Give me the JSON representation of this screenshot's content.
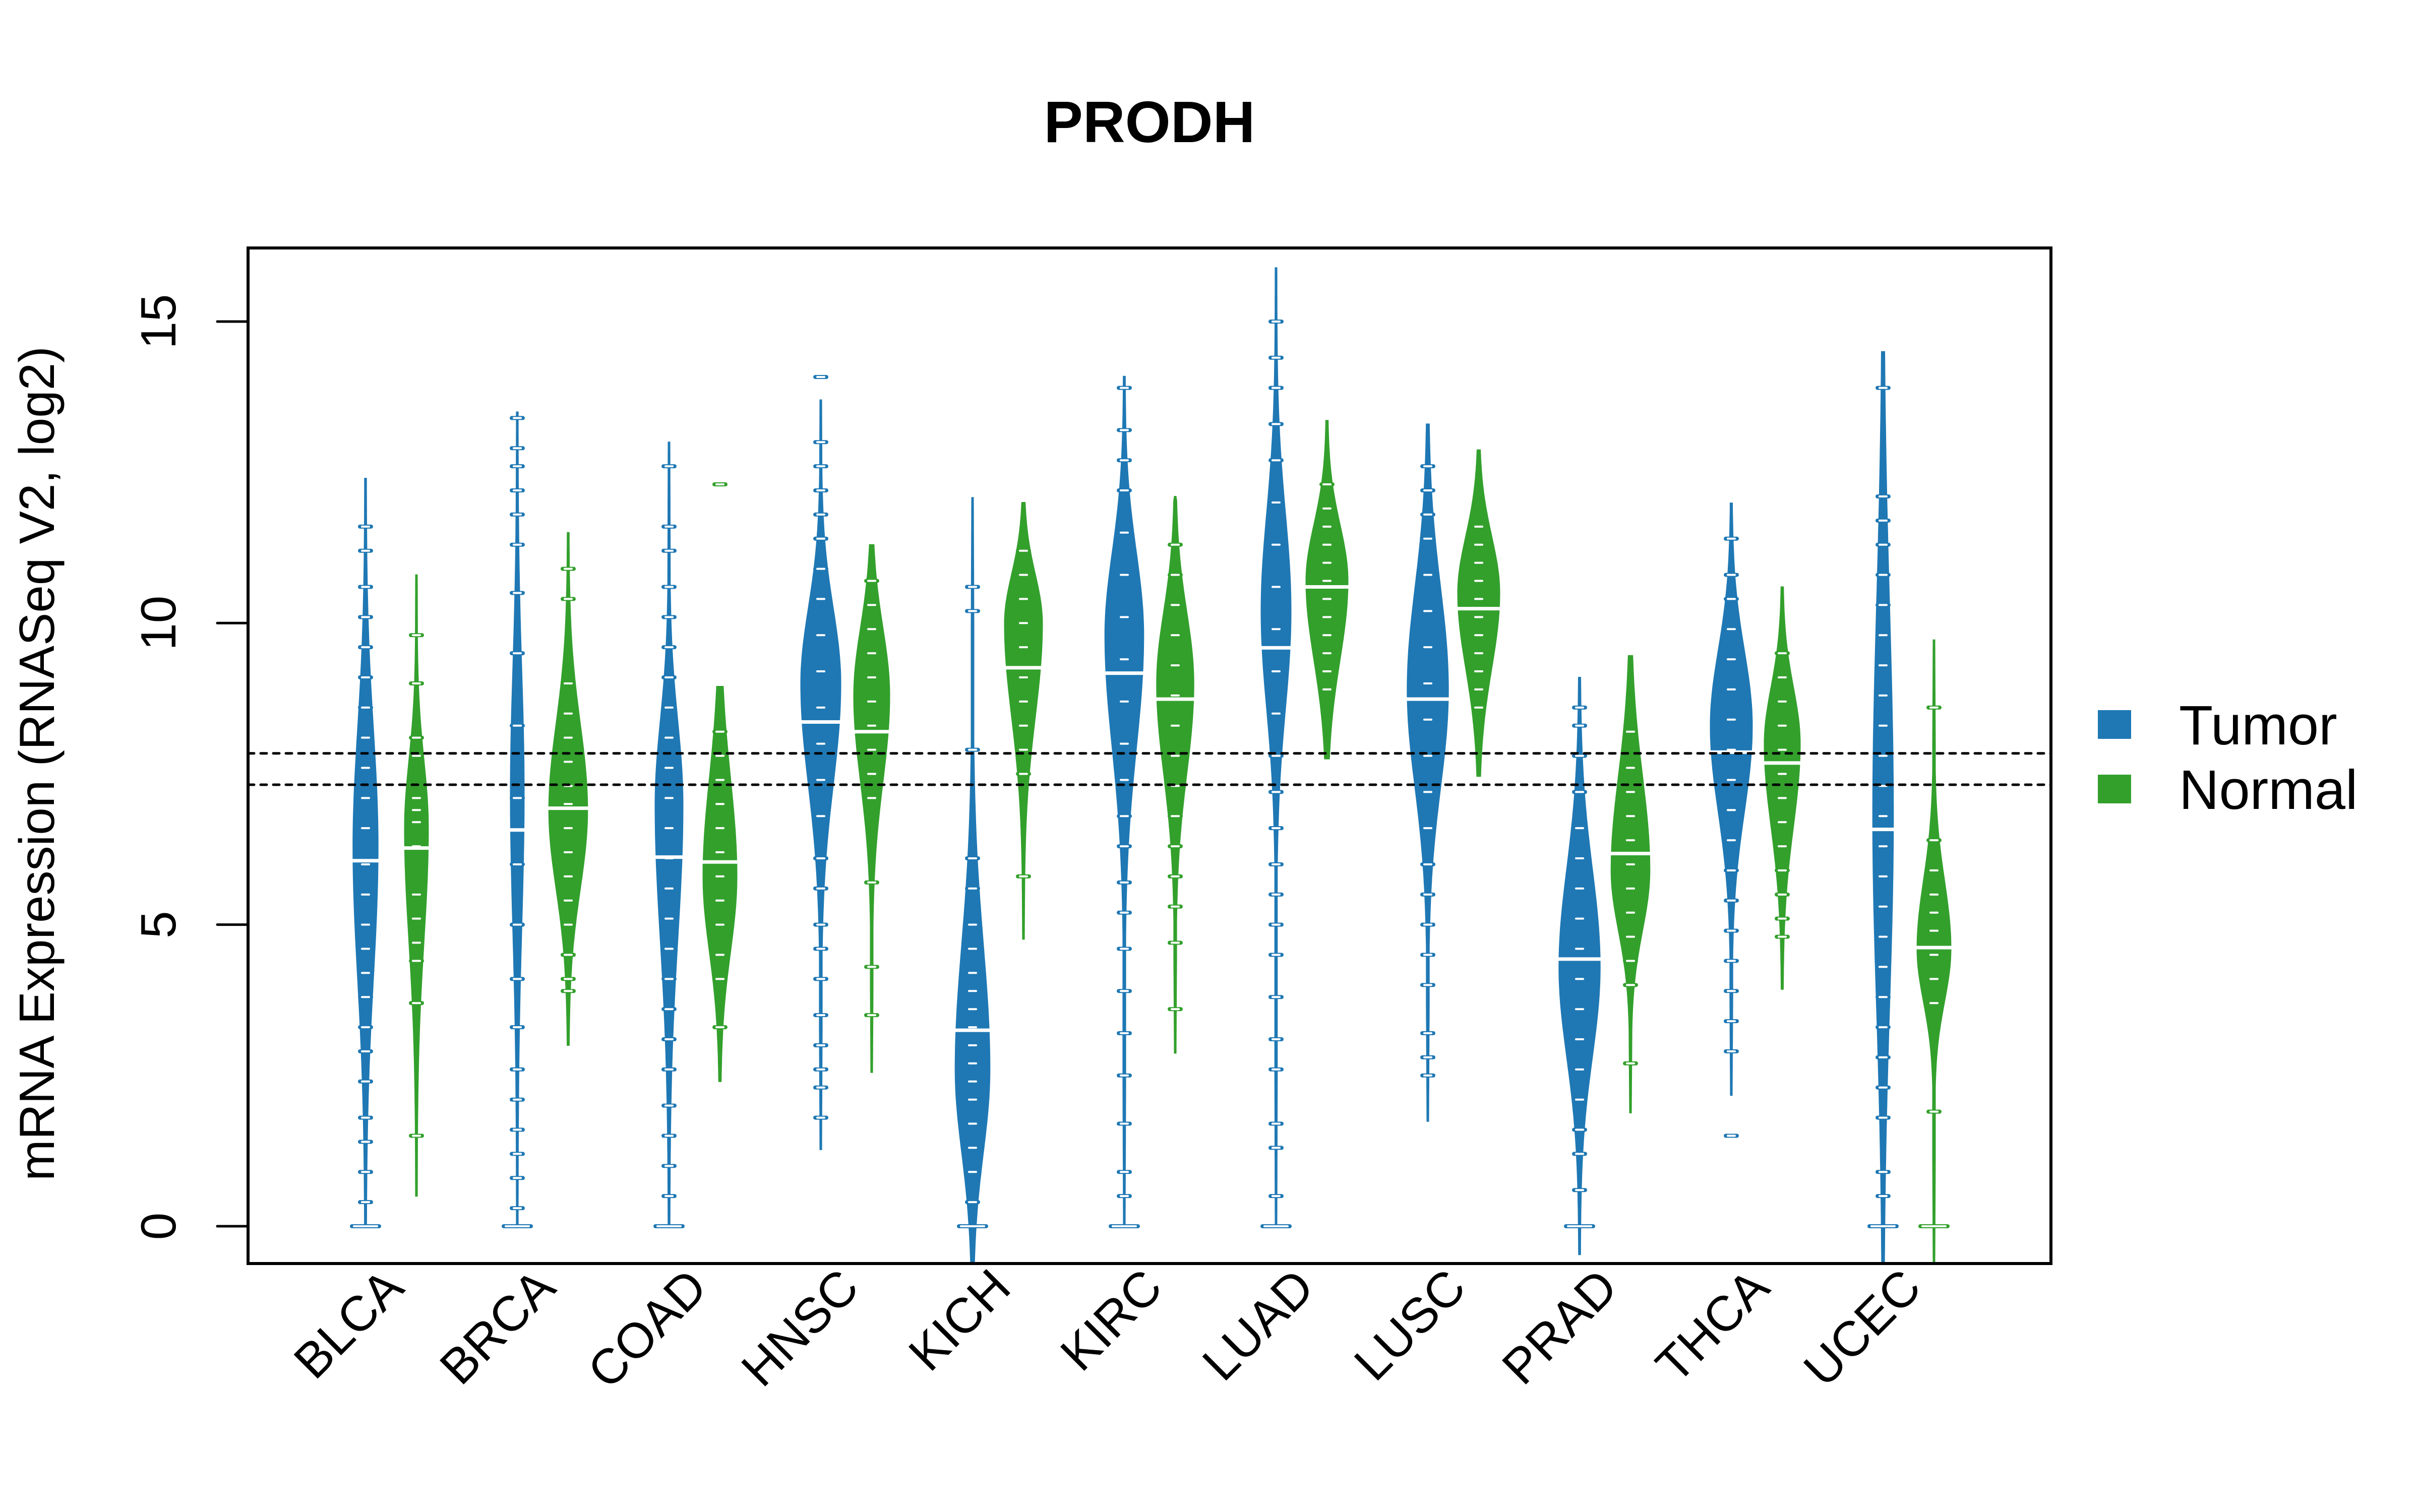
{
  "chart_data": {
    "type": "violin",
    "title": "PRODH",
    "xlabel": "",
    "ylabel": "mRNA Expression (RNASeq V2, log2)",
    "ylim": [
      -0.62,
      16.2
    ],
    "yticks": [
      0,
      5,
      10,
      15
    ],
    "ytick_labels": [
      "0",
      "5",
      "10",
      "15"
    ],
    "grid": false,
    "reference_lines": [
      7.84,
      7.32
    ],
    "legend": {
      "position": "right",
      "entries": [
        {
          "name": "Tumor",
          "color": "#1f78b4"
        },
        {
          "name": "Normal",
          "color": "#33a02c"
        }
      ]
    },
    "categories": [
      "BLCA",
      "BRCA",
      "COAD",
      "HNSC",
      "KICH",
      "KIRC",
      "LUAD",
      "LUSC",
      "PRAD",
      "THCA",
      "UCEC"
    ],
    "series": [
      {
        "name": "Tumor",
        "color": "#1f78b4",
        "values": [
          {
            "min": 0.0,
            "max": 12.4,
            "median": 6.06,
            "mode": 6.3,
            "body_low": 2.8,
            "body_high": 9.4,
            "width": 0.58,
            "points": [
              0,
              0.4,
              0.9,
              1.4,
              1.8,
              2.4,
              2.9,
              3.3,
              3.8,
              4.2,
              4.6,
              5.0,
              5.5,
              6.0,
              6.6,
              7.1,
              7.6,
              8.1,
              8.6,
              9.1,
              9.6,
              10.1,
              10.6,
              11.2,
              11.6
            ]
          },
          {
            "min": 0.0,
            "max": 13.5,
            "median": 6.57,
            "mode": 7.2,
            "body_low": 3.6,
            "body_high": 10.4,
            "width": 0.3,
            "points": [
              0,
              0.3,
              0.8,
              1.2,
              1.6,
              2.1,
              2.6,
              3.3,
              4.1,
              5.0,
              6.0,
              7.1,
              8.3,
              9.5,
              10.5,
              11.3,
              11.8,
              12.2,
              12.6,
              12.9,
              13.4
            ]
          },
          {
            "min": 0.0,
            "max": 13.0,
            "median": 6.12,
            "mode": 7.0,
            "body_low": 3.4,
            "body_high": 9.2,
            "width": 0.65,
            "points": [
              0,
              0.5,
              1.0,
              1.5,
              2.0,
              2.6,
              3.1,
              3.6,
              4.1,
              4.6,
              5.1,
              5.6,
              6.1,
              6.6,
              7.1,
              7.6,
              8.1,
              8.6,
              9.1,
              9.6,
              10.1,
              10.6,
              11.2,
              11.6,
              12.6
            ]
          },
          {
            "min": 1.27,
            "max": 13.7,
            "median": 8.36,
            "mode": 9.0,
            "body_low": 6.3,
            "body_high": 11.0,
            "width": 0.95,
            "points": [
              1.8,
              2.3,
              2.6,
              3.0,
              3.5,
              4.1,
              4.6,
              5.0,
              5.6,
              6.1,
              6.8,
              7.4,
              8.0,
              8.6,
              9.2,
              9.8,
              10.4,
              10.9,
              11.4,
              11.8,
              12.2,
              12.6,
              13.0,
              14.08
            ]
          },
          {
            "min": -0.62,
            "max": 12.08,
            "median": 3.25,
            "mode": 2.6,
            "body_low": 0.4,
            "body_high": 5.9,
            "width": 0.82,
            "points": [
              0,
              0.4,
              0.9,
              1.3,
              1.7,
              2.1,
              2.4,
              2.7,
              3.0,
              3.3,
              3.6,
              3.9,
              4.2,
              4.6,
              5.0,
              5.6,
              6.1,
              7.9,
              10.2,
              10.6
            ]
          },
          {
            "min": 0.0,
            "max": 14.09,
            "median": 9.17,
            "mode": 9.8,
            "body_low": 6.8,
            "body_high": 12.0,
            "width": 0.92,
            "points": [
              0,
              0.5,
              0.9,
              1.7,
              2.5,
              3.2,
              3.9,
              4.6,
              5.2,
              5.7,
              6.3,
              6.8,
              7.4,
              8.0,
              8.7,
              9.4,
              10.1,
              10.8,
              11.5,
              12.2,
              12.7,
              13.2,
              13.9
            ]
          },
          {
            "min": 0.0,
            "max": 15.89,
            "median": 9.59,
            "mode": 10.2,
            "body_low": 7.6,
            "body_high": 12.8,
            "width": 0.7,
            "points": [
              0,
              0.5,
              1.3,
              1.7,
              2.6,
              3.1,
              3.8,
              4.5,
              5.0,
              5.5,
              6.0,
              6.6,
              7.2,
              7.8,
              8.5,
              9.2,
              9.9,
              10.6,
              11.3,
              12.0,
              12.7,
              13.3,
              13.9,
              14.4,
              15.0
            ]
          },
          {
            "min": 1.74,
            "max": 13.3,
            "median": 8.74,
            "mode": 8.9,
            "body_low": 6.3,
            "body_high": 11.6,
            "width": 0.98,
            "points": [
              2.5,
              2.8,
              3.2,
              4.0,
              4.5,
              5.0,
              5.5,
              6.0,
              6.6,
              7.2,
              7.8,
              8.4,
              9.0,
              9.6,
              10.2,
              10.8,
              11.4,
              11.8,
              12.2,
              12.6
            ]
          },
          {
            "min": -0.47,
            "max": 9.1,
            "median": 4.43,
            "mode": 4.3,
            "body_low": 1.9,
            "body_high": 6.9,
            "width": 0.98,
            "points": [
              0,
              0.6,
              1.2,
              1.6,
              2.1,
              2.6,
              3.1,
              3.6,
              4.1,
              4.6,
              5.1,
              5.6,
              6.1,
              6.6,
              7.2,
              7.8,
              8.3,
              8.6
            ]
          },
          {
            "min": 2.17,
            "max": 11.99,
            "median": 7.86,
            "mode": 8.3,
            "body_low": 6.0,
            "body_high": 10.3,
            "width": 1.0,
            "points": [
              1.5,
              2.9,
              3.4,
              3.9,
              4.4,
              4.9,
              5.4,
              5.9,
              6.4,
              6.9,
              7.4,
              7.9,
              8.4,
              8.9,
              9.4,
              9.9,
              10.4,
              10.8,
              11.4
            ]
          },
          {
            "min": -0.62,
            "max": 14.5,
            "median": 6.58,
            "mode": 6.8,
            "body_low": 1.8,
            "body_high": 12.3,
            "width": 0.47,
            "points": [
              0,
              0.5,
              0.9,
              1.8,
              2.3,
              2.8,
              3.3,
              3.8,
              4.3,
              4.8,
              5.3,
              5.8,
              6.3,
              6.8,
              7.3,
              7.8,
              8.3,
              8.8,
              9.3,
              9.8,
              10.3,
              10.8,
              11.3,
              11.7,
              12.1,
              13.9
            ]
          }
        ]
      },
      {
        "name": "Normal",
        "color": "#33a02c",
        "values": [
          {
            "min": 0.5,
            "max": 10.8,
            "median": 6.27,
            "mode": 6.6,
            "body_low": 3.6,
            "body_high": 8.4,
            "width": 0.55,
            "points": [
              1.5,
              3.7,
              4.4,
              4.7,
              5.1,
              5.5,
              6.3,
              6.7,
              6.9,
              7.1,
              7.8,
              8.1,
              9.0,
              9.8
            ]
          },
          {
            "min": 3.0,
            "max": 11.5,
            "median": 6.93,
            "mode": 6.9,
            "body_low": 4.8,
            "body_high": 9.2,
            "width": 0.92,
            "points": [
              3.9,
              4.1,
              4.5,
              5.0,
              5.4,
              5.8,
              6.2,
              6.6,
              7.0,
              7.3,
              7.7,
              8.1,
              8.5,
              9.0,
              10.4,
              10.9
            ]
          },
          {
            "min": 2.4,
            "max": 8.95,
            "median": 6.04,
            "mode": 5.8,
            "body_low": 3.8,
            "body_high": 8.4,
            "width": 0.8,
            "points": [
              3.3,
              4.1,
              4.5,
              5.0,
              5.4,
              5.8,
              6.2,
              6.6,
              7.0,
              7.4,
              7.8,
              8.2,
              12.3
            ]
          },
          {
            "min": 2.55,
            "max": 11.3,
            "median": 8.2,
            "mode": 8.8,
            "body_low": 6.5,
            "body_high": 10.6,
            "width": 0.85,
            "points": [
              3.5,
              4.3,
              5.7,
              7.1,
              7.5,
              7.9,
              8.3,
              8.7,
              9.1,
              9.5,
              9.9,
              10.3,
              10.7
            ]
          },
          {
            "min": 4.76,
            "max": 12.0,
            "median": 9.26,
            "mode": 10.0,
            "body_low": 7.5,
            "body_high": 11.3,
            "width": 0.9,
            "points": [
              5.8,
              7.5,
              7.9,
              8.3,
              8.7,
              9.1,
              9.6,
              10.0,
              10.4,
              10.8,
              11.2
            ]
          },
          {
            "min": 2.87,
            "max": 12.1,
            "median": 8.74,
            "mode": 9.0,
            "body_low": 6.6,
            "body_high": 10.9,
            "width": 0.88,
            "points": [
              3.6,
              4.7,
              5.3,
              5.8,
              6.3,
              6.8,
              7.3,
              7.8,
              8.3,
              8.8,
              9.3,
              9.8,
              10.3,
              10.8,
              11.3
            ]
          },
          {
            "min": 7.75,
            "max": 13.36,
            "median": 10.6,
            "mode": 10.7,
            "body_low": 8.6,
            "body_high": 12.2,
            "width": 1.0,
            "points": [
              8.9,
              9.2,
              9.5,
              9.8,
              10.1,
              10.4,
              10.7,
              11.0,
              11.3,
              11.6,
              11.9,
              12.3
            ]
          },
          {
            "min": 7.46,
            "max": 12.87,
            "median": 10.24,
            "mode": 10.5,
            "body_low": 8.5,
            "body_high": 12.0,
            "width": 1.0,
            "points": [
              8.6,
              8.9,
              9.2,
              9.5,
              9.8,
              10.1,
              10.4,
              10.7,
              11.0,
              11.3,
              11.6
            ]
          },
          {
            "min": 1.88,
            "max": 9.46,
            "median": 6.18,
            "mode": 5.9,
            "body_low": 4.3,
            "body_high": 8.4,
            "width": 0.92,
            "points": [
              2.7,
              4.0,
              4.4,
              4.8,
              5.2,
              5.6,
              6.0,
              6.4,
              6.8,
              7.2,
              7.6,
              8.2
            ]
          },
          {
            "min": 3.93,
            "max": 10.6,
            "median": 7.68,
            "mode": 8.0,
            "body_low": 5.8,
            "body_high": 9.5,
            "width": 0.85,
            "points": [
              4.8,
              5.1,
              5.5,
              5.9,
              6.3,
              6.7,
              7.1,
              7.5,
              7.9,
              8.3,
              8.7,
              9.1,
              9.5
            ]
          },
          {
            "min": -0.62,
            "max": 9.72,
            "median": 4.62,
            "mode": 4.6,
            "body_low": 3.2,
            "body_high": 6.4,
            "width": 0.8,
            "points": [
              0,
              1.9,
              3.7,
              4.1,
              4.5,
              4.9,
              5.2,
              5.5,
              5.9,
              6.4,
              8.6
            ]
          }
        ]
      }
    ]
  }
}
